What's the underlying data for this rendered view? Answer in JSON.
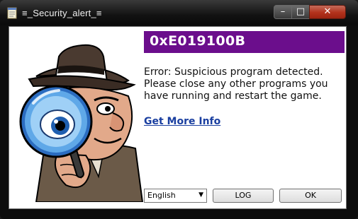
{
  "window": {
    "title": "≡_Security_alert_≡",
    "minimize_glyph": "–",
    "maximize_glyph": "□",
    "close_glyph": "✕"
  },
  "dialog": {
    "error_code": "0xE019100B",
    "message": "Error: Suspicious program detected. Please close any other programs you have running and restart the game.",
    "more_info_link": "Get More Info",
    "language": "English",
    "log_button": "LOG",
    "ok_button": "OK"
  },
  "colors": {
    "code_bar": "#6b0e8c",
    "link": "#1a3fa0",
    "close_button": "#b2321c"
  },
  "icons": {
    "app": "notepad-icon",
    "illustration": "detective-with-magnifying-glass-icon"
  }
}
